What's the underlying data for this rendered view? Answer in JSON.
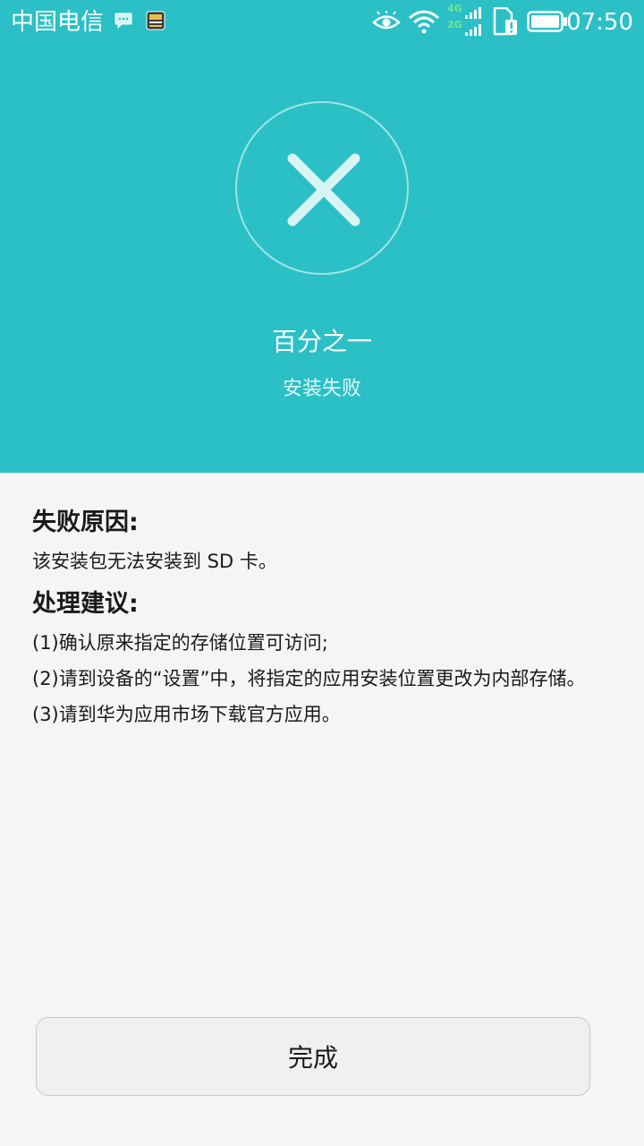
{
  "status_bar": {
    "carrier": "中国电信",
    "time": "07:50",
    "network_4g": "4G",
    "network_2g": "2G"
  },
  "header": {
    "app_name": "百分之一",
    "status": "安装失败"
  },
  "content": {
    "reason_title": "失败原因:",
    "reason_text": "该安装包无法安装到 SD 卡。",
    "suggestion_title": "处理建议:",
    "suggestions": [
      "(1)确认原来指定的存储位置可访问;",
      "(2)请到设备的“设置”中，将指定的应用安装位置更改为内部存储。",
      "(3)请到华为应用市场下载官方应用。"
    ]
  },
  "footer": {
    "done_label": "完成"
  },
  "colors": {
    "accent": "#2ac0c6",
    "background": "#f5f5f5"
  }
}
